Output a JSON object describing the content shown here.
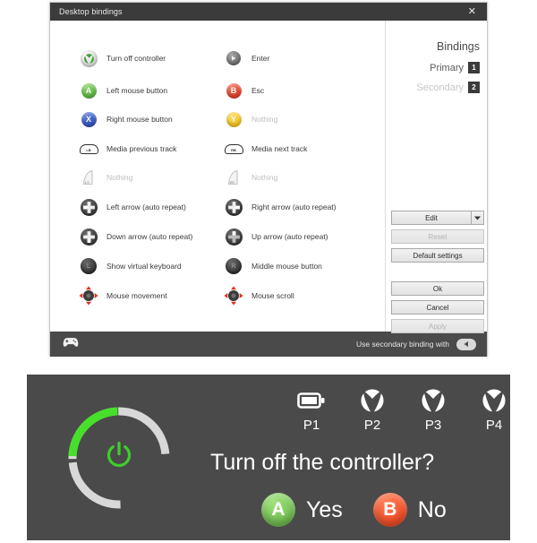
{
  "window": {
    "title": "Desktop bindings",
    "close_icon": "close-icon"
  },
  "bindings": {
    "left_column": [
      {
        "icon": "xbox-guide-button-icon",
        "label": "Turn off controller",
        "dim": false
      },
      {
        "icon": "a-button-icon",
        "label": "Left mouse button",
        "dim": false
      },
      {
        "icon": "x-button-icon",
        "label": "Right mouse button",
        "dim": false
      },
      {
        "icon": "left-bumper-icon",
        "label": "Media previous track",
        "dim": false
      },
      {
        "icon": "left-trigger-icon",
        "label": "Nothing",
        "dim": true
      },
      {
        "icon": "dpad-left-icon",
        "label": "Left arrow (auto repeat)",
        "dim": false
      },
      {
        "icon": "dpad-down-icon",
        "label": "Down arrow (auto repeat)",
        "dim": false
      },
      {
        "icon": "left-stick-button-icon",
        "label": "Show virtual keyboard",
        "dim": false
      },
      {
        "icon": "left-stick-move-icon",
        "label": "Mouse movement",
        "dim": false
      }
    ],
    "right_column": [
      {
        "icon": "start-button-icon",
        "label": "Enter",
        "dim": false
      },
      {
        "icon": "b-button-icon",
        "label": "Esc",
        "dim": false
      },
      {
        "icon": "y-button-icon",
        "label": "Nothing",
        "dim": true
      },
      {
        "icon": "right-bumper-icon",
        "label": "Media next track",
        "dim": false
      },
      {
        "icon": "right-trigger-icon",
        "label": "Nothing",
        "dim": true
      },
      {
        "icon": "dpad-right-icon",
        "label": "Right arrow (auto repeat)",
        "dim": false
      },
      {
        "icon": "dpad-up-icon",
        "label": "Up arrow (auto repeat)",
        "dim": false
      },
      {
        "icon": "right-stick-button-icon",
        "label": "Middle mouse button",
        "dim": false
      },
      {
        "icon": "right-stick-move-icon",
        "label": "Mouse scroll",
        "dim": false
      }
    ],
    "button_glyphs": {
      "a": "A",
      "b": "B",
      "x": "X",
      "y": "Y",
      "lb": "LB",
      "rb": "RB",
      "lt": "LT",
      "rt": "RT",
      "l_stick": "L",
      "r_stick": "R"
    }
  },
  "panel": {
    "heading": "Bindings",
    "primary_label": "Primary",
    "primary_num": "1",
    "secondary_label": "Secondary",
    "secondary_num": "2"
  },
  "buttons": {
    "edit": "Edit",
    "edit_arrow_icon": "chevron-down-icon",
    "reset": "Reset",
    "default_settings": "Default settings",
    "ok": "Ok",
    "cancel": "Cancel",
    "apply": "Apply"
  },
  "footer": {
    "gamepad_icon": "gamepad-icon",
    "secondary_binding_text": "Use secondary binding with",
    "lb_icon": "left-bumper-icon"
  },
  "shutdown": {
    "question": "Turn off the controller?",
    "players": [
      {
        "icon": "battery-icon",
        "label": "P1"
      },
      {
        "icon": "xbox-logo-icon",
        "label": "P2"
      },
      {
        "icon": "xbox-logo-icon",
        "label": "P3"
      },
      {
        "icon": "xbox-logo-icon",
        "label": "P4"
      }
    ],
    "answers": [
      {
        "button": "A",
        "label": "Yes",
        "style": "ans-a"
      },
      {
        "button": "B",
        "label": "No",
        "style": "ans-b"
      }
    ],
    "power_icon": "power-icon"
  },
  "colors": {
    "accent_green": "#5fd33a",
    "button_a": "#45a833",
    "button_b": "#dd2410",
    "button_x": "#1f3fb0",
    "button_y": "#f0b500",
    "panel_bg": "#4a4a4a",
    "titlebar_bg": "#3b3b3b"
  }
}
